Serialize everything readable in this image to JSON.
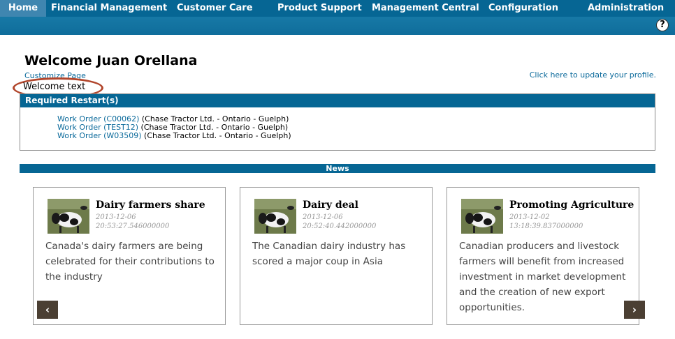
{
  "nav": {
    "items": [
      {
        "label": "Home"
      },
      {
        "label": "Financial Management"
      },
      {
        "label": "Customer Care"
      },
      {
        "label": "Product Support"
      },
      {
        "label": "Management Central"
      },
      {
        "label": "Configuration"
      },
      {
        "label": "Administration"
      }
    ]
  },
  "help": {
    "label": "?"
  },
  "welcome": {
    "title": "Welcome Juan Orellana",
    "customize": "Customize Page",
    "profile": "Click here to update your profile.",
    "text": "Welcome text"
  },
  "restart": {
    "header": "Required Restart(s)",
    "rows": [
      {
        "link": "Work Order (C00062)",
        "detail": " (Chase Tractor Ltd. - Ontario - Guelph)"
      },
      {
        "link": "Work Order (TEST12)",
        "detail": " (Chase Tractor Ltd. - Ontario - Guelph)"
      },
      {
        "link": "Work Order (W03509)",
        "detail": " (Chase Tractor Ltd. - Ontario - Guelph)"
      }
    ]
  },
  "news": {
    "header": "News",
    "prev": "‹",
    "next": "›",
    "cards": [
      {
        "title": "Dairy farmers share",
        "date": "2013-12-06",
        "time": "20:53:27.546000000",
        "body": "Canada's dairy farmers are being celebrated for their contributions to the industry"
      },
      {
        "title": "Dairy deal",
        "date": "2013-12-06",
        "time": "20:52:40.442000000",
        "body": "The Canadian dairy industry has scored a major coup in Asia"
      },
      {
        "title": "Promoting Agriculture",
        "date": "2013-12-02",
        "time": "13:18:39.837000000",
        "body": "Canadian producers and livestock farmers will benefit from increased investment in market development and the creation of new export opportunities."
      }
    ]
  },
  "colors": {
    "nav": "#066694",
    "link": "#0b6a9b",
    "highlight": "#b1452b",
    "arrow": "#4b3f33"
  }
}
